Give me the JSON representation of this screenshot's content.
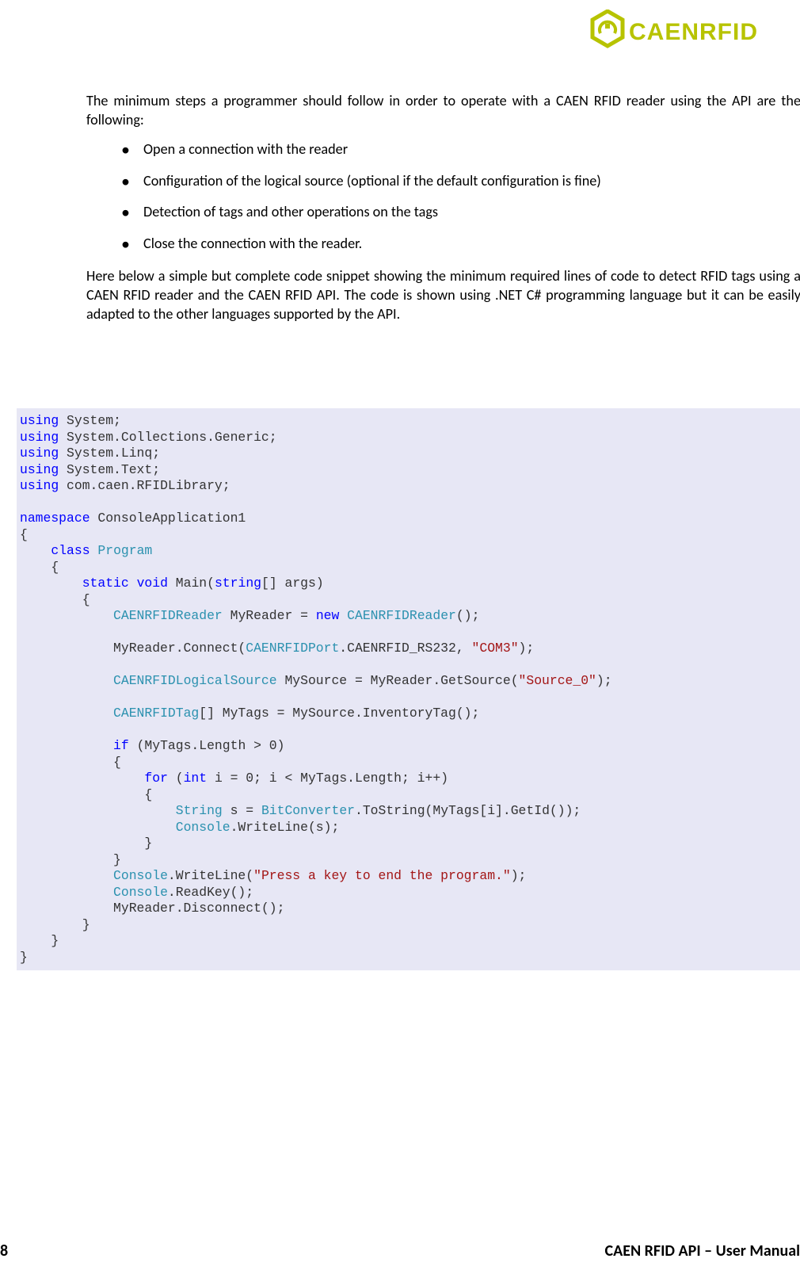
{
  "header": {
    "brand": "CAENRFID"
  },
  "body": {
    "para1": "The minimum steps a programmer should follow in order to operate with a CAEN RFID reader using the API are the following:",
    "steps": [
      "Open a connection with the reader",
      "Configuration of the logical source (optional if the default configuration is fine)",
      "Detection of tags and other operations on the tags",
      "Close the connection with the reader."
    ],
    "para2": "Here below a simple but complete code snippet showing the minimum required lines of code to detect RFID tags using a CAEN RFID reader and the CAEN RFID API. The code is shown using .NET C# programming language but it can be easily adapted to the other languages supported by the API."
  },
  "code": {
    "kw_using": "using",
    "ns_system": "System;",
    "ns_generic": "System.Collections.Generic;",
    "ns_linq": "System.Linq;",
    "ns_text": "System.Text;",
    "ns_caen": "com.caen.RFIDLibrary;",
    "kw_namespace": "namespace",
    "ns_app": "ConsoleApplication1",
    "kw_class": "class",
    "cls_program": "Program",
    "kw_static": "static",
    "kw_void": "void",
    "fn_main": "Main(",
    "kw_string_arr": "string",
    "main_tail": "[] args)",
    "t_reader": "CAENRFIDReader",
    "line_reader_mid": " MyReader = ",
    "kw_new": "new",
    "line_reader_end": "();",
    "line_connect_a": "            MyReader.Connect(",
    "t_port": "CAENRFIDPort",
    "line_connect_b": ".CAENRFID_RS232, ",
    "str_com3": "\"COM3\"",
    "line_connect_c": ");",
    "t_lsrc": "CAENRFIDLogicalSource",
    "line_src_mid": " MySource = MyReader.GetSource(",
    "str_src0": "\"Source_0\"",
    "line_src_end": ");",
    "t_tag": "CAENRFIDTag",
    "line_tags": "[] MyTags = MySource.InventoryTag();",
    "kw_if": "if",
    "line_if_cond": " (MyTags.Length > 0)",
    "kw_for": "for",
    "line_for_a": " (",
    "kw_int": "int",
    "line_for_b": " i = 0; i < MyTags.Length; i++)",
    "t_String": "String",
    "line_bc_a": " s = ",
    "t_BitConverter": "BitConverter",
    "line_bc_b": ".ToString(MyTags[i].GetId());",
    "t_Console": "Console",
    "line_wl_s": ".WriteLine(s);",
    "line_wl_press_a": ".WriteLine(",
    "str_press": "\"Press a key to end the program.\"",
    "line_wl_press_b": ");",
    "line_readkey": ".ReadKey();",
    "line_disc": "            MyReader.Disconnect();"
  },
  "footer": {
    "page_number": "8",
    "title": "CAEN RFID API – User Manual"
  }
}
